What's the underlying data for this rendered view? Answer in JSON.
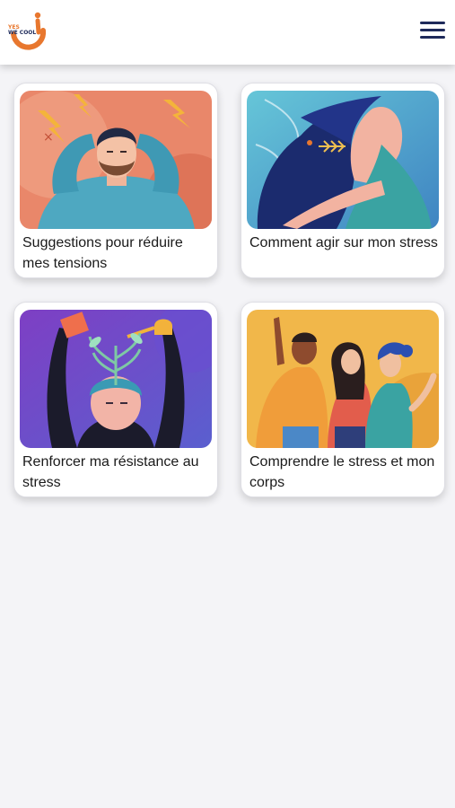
{
  "brand": {
    "logo_line1": "YES",
    "logo_line2": "WE COOL",
    "logo_icon": "smile-logo-icon"
  },
  "header": {
    "menu_icon": "hamburger-menu-icon"
  },
  "colors": {
    "brand_orange": "#e8772e",
    "brand_navy": "#1e2a5a",
    "background": "#f4f4f7"
  },
  "cards": [
    {
      "label": "Suggestions pour réduire mes tensions",
      "image": "stressed-man-lightning-illustration"
    },
    {
      "label": "Comment agir sur mon stress",
      "image": "woman-wind-hair-illustration"
    },
    {
      "label": "Renforcer ma résistance au stress",
      "image": "watering-mind-plant-illustration"
    },
    {
      "label": "Comprendre le stress et mon corps",
      "image": "friends-group-illustration"
    }
  ]
}
